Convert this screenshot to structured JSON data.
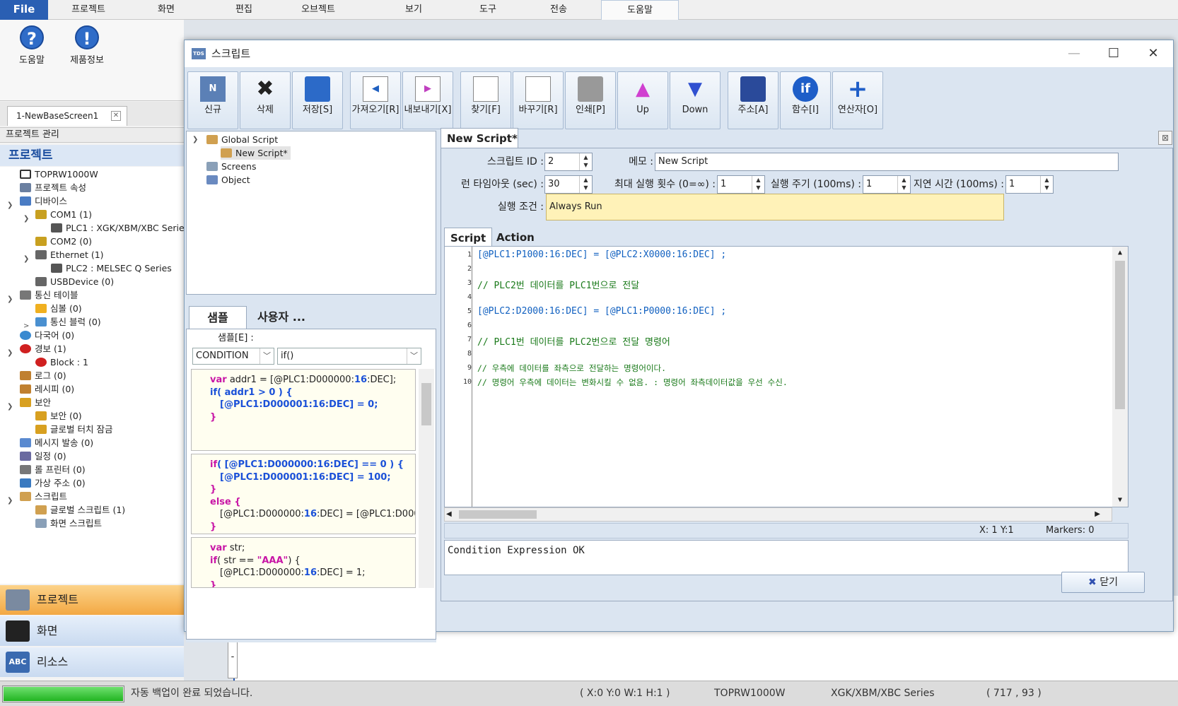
{
  "menu": {
    "file": "File",
    "items": [
      "프로젝트",
      "화면",
      "편집",
      "오브젝트",
      "보기",
      "도구",
      "전송",
      "도움말"
    ],
    "active_index": 7
  },
  "ribbon": {
    "help": "도움말",
    "product_info": "제품정보"
  },
  "screen_tab": {
    "label": "1-NewBaseScreen1"
  },
  "left_panel": {
    "project_manager": "프로젝트 관리",
    "title": "프로젝트",
    "tree": [
      {
        "label": "TOPRW1000W",
        "icon": "monitor-icon"
      },
      {
        "label": "프로젝트 속성",
        "icon": "properties-icon"
      },
      {
        "label": "디바이스",
        "icon": "device-icon"
      },
      {
        "label": "COM1 (1)",
        "icon": "com-port-icon"
      },
      {
        "label": "PLC1 : XGK/XBM/XBC Series",
        "icon": "plc-icon"
      },
      {
        "label": "COM2 (0)",
        "icon": "com-port-icon"
      },
      {
        "label": "Ethernet (1)",
        "icon": "ethernet-icon"
      },
      {
        "label": "PLC2 : MELSEC Q Series",
        "icon": "plc-icon"
      },
      {
        "label": "USBDevice (0)",
        "icon": "usb-icon"
      },
      {
        "label": "통신 테이블",
        "icon": "table-icon"
      },
      {
        "label": "심볼 (0)",
        "icon": "star-icon"
      },
      {
        "label": "통신 블럭 (0)",
        "icon": "block-icon"
      },
      {
        "label": "다국어 (0)",
        "icon": "globe-icon"
      },
      {
        "label": "경보 (1)",
        "icon": "alarm-icon"
      },
      {
        "label": "Block : 1",
        "icon": "alarm-icon"
      },
      {
        "label": "로그 (0)",
        "icon": "log-icon"
      },
      {
        "label": "레시피 (0)",
        "icon": "recipe-icon"
      },
      {
        "label": "보안",
        "icon": "lock-icon"
      },
      {
        "label": "보안 (0)",
        "icon": "lock-icon"
      },
      {
        "label": "글로벌 터치 잠금",
        "icon": "lock-icon"
      },
      {
        "label": "메시지 발송 (0)",
        "icon": "mail-icon"
      },
      {
        "label": "일정 (0)",
        "icon": "calendar-icon"
      },
      {
        "label": "롤 프린터 (0)",
        "icon": "printer-icon"
      },
      {
        "label": "가상 주소 (0)",
        "icon": "virtual-address-icon"
      },
      {
        "label": "스크립트",
        "icon": "script-icon"
      },
      {
        "label": "글로벌 스크립트 (1)",
        "icon": "script-icon"
      },
      {
        "label": "화면 스크립트",
        "icon": "screen-script-icon"
      }
    ],
    "nav": [
      "프로젝트",
      "화면",
      "리소스"
    ]
  },
  "dialog": {
    "title": "스크립트",
    "logo": "TDS",
    "toolbar": [
      {
        "label": "신규",
        "icon": "new-icon"
      },
      {
        "label": "삭제",
        "icon": "delete-icon"
      },
      {
        "label": "저장[S]",
        "icon": "save-icon"
      },
      {
        "label": "가져오기[R]",
        "icon": "import-icon"
      },
      {
        "label": "내보내기[X]",
        "icon": "export-icon"
      },
      {
        "label": "찾기[F]",
        "icon": "find-icon"
      },
      {
        "label": "바꾸기[R]",
        "icon": "replace-icon"
      },
      {
        "label": "인쇄[P]",
        "icon": "print-icon"
      },
      {
        "label": "Up",
        "icon": "up-icon"
      },
      {
        "label": "Down",
        "icon": "down-icon"
      },
      {
        "label": "주소[A]",
        "icon": "address-icon"
      },
      {
        "label": "함수[I]",
        "icon": "function-icon"
      },
      {
        "label": "연산자[O]",
        "icon": "operator-icon"
      }
    ],
    "script_tree": [
      "Global Script",
      "New Script*",
      "Screens",
      "Object"
    ],
    "samples": {
      "tabs": [
        "샘플",
        "사용자 ..."
      ],
      "label": "샘플[E] :",
      "category": "CONDITION",
      "item": "if()"
    },
    "editor": {
      "tab": "New Script*",
      "script_id_label": "스크립트 ID :",
      "script_id": "2",
      "memo_label": "메모 :",
      "memo": "New Script",
      "runtimeout_label": "런 타임아웃 (sec) :",
      "runtimeout": "30",
      "maxrun_label": "최대 실행 횟수 (0=∞) :",
      "maxrun": "1",
      "period_label": "실행 주기 (100ms) :",
      "period": "1",
      "delay_label": "지연 시간 (100ms) :",
      "delay": "1",
      "condition_label": "실행 조건 :",
      "condition": "Always Run",
      "tabs": [
        "Script",
        "Action"
      ],
      "lines": [
        "[@PLC1:P1000:16:DEC] = [@PLC2:X0000:16:DEC] ;",
        "",
        "// PLC2번 데이터를 PLC1번으로 전달",
        "",
        "[@PLC2:D2000:16:DEC] = [@PLC1:P0000:16:DEC] ;",
        "",
        "// PLC1번 데이터를 PLC2번으로 전달 명령어",
        "",
        "// 우측에 데이터를 좌측으로 전달하는 명령어이다.",
        "// 명령어 우측에 데이터는 변화시킬 수 없음. : 명령어 좌측데이터값을 우선 수신."
      ],
      "line_numbers": [
        "1",
        "2",
        "3",
        "4",
        "5",
        "6",
        "7",
        "8",
        "9",
        "10"
      ],
      "position": "X: 1   Y:1",
      "markers": "Markers: 0",
      "output": "Condition Expression OK"
    },
    "close": "닫기"
  },
  "status": {
    "message": "자동 백업이 완료 되었습니다.",
    "coords": "( X:0 Y:0 W:1 H:1 )",
    "model": "TOPRW1000W",
    "series": "XGK/XBM/XBC Series",
    "cursor": "( 717 , 93 )",
    "progress": 1.0
  },
  "colors": {
    "accent": "#2a5fb3",
    "condition_bg": "#fff2b8",
    "active_nav": "#f3a843"
  }
}
